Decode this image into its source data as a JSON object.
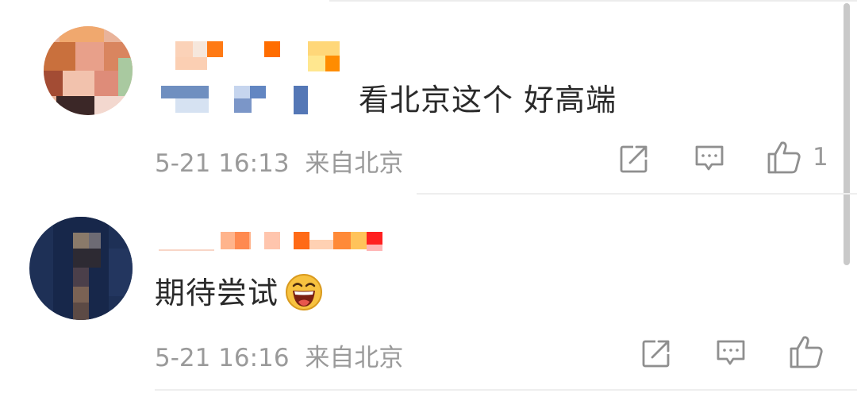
{
  "comments": [
    {
      "text": "看北京这个  好高端",
      "timestamp": "5-21 16:13",
      "location": "来自北京",
      "likes": "1",
      "icons": [
        "share-icon",
        "comment-icon",
        "like-icon"
      ]
    },
    {
      "text": "期待尝试",
      "emoji": "grinning-face",
      "timestamp": "5-21 16:16",
      "location": "来自北京",
      "icons": [
        "share-icon",
        "comment-icon",
        "like-icon"
      ]
    }
  ],
  "colors": {
    "text": "#2a2a2a",
    "meta": "#9a9a9a",
    "divider": "#eeeeee"
  }
}
